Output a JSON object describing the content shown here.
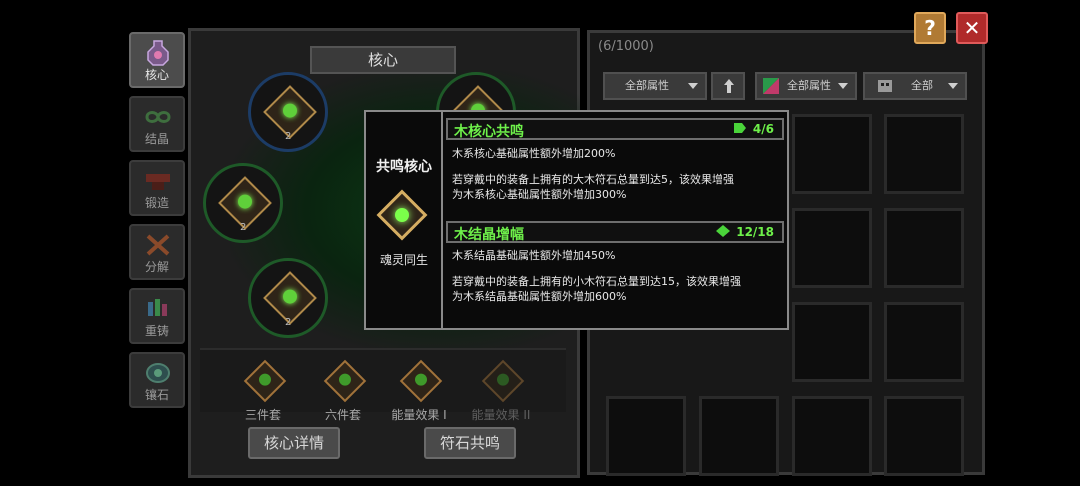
{
  "sidebar": {
    "items": [
      {
        "label": "核心",
        "icon": "vase-icon",
        "active": true
      },
      {
        "label": "结晶",
        "icon": "infinity-crystal-icon"
      },
      {
        "label": "锻造",
        "icon": "anvil-icon"
      },
      {
        "label": "分解",
        "icon": "decompose-icon"
      },
      {
        "label": "重铸",
        "icon": "recast-crystals-icon"
      },
      {
        "label": "镶石",
        "icon": "socket-stone-icon"
      }
    ]
  },
  "core": {
    "title": "核心",
    "sockets": [
      {
        "level": "2"
      },
      {
        "level": "2"
      },
      {
        "level": "2"
      },
      {
        "level": ""
      }
    ],
    "sets": [
      {
        "label": "三件套",
        "dim": false
      },
      {
        "label": "六件套",
        "dim": false
      },
      {
        "label": "能量效果 I",
        "dim": false
      },
      {
        "label": "能量效果 II",
        "dim": true
      }
    ],
    "detail_button": "核心详情",
    "resonance_button": "符石共鸣"
  },
  "inventory": {
    "count": "(6/1000)",
    "filters": {
      "attr1": "全部属性",
      "sort_icon": "up-arrow-icon",
      "attr2": "全部属性",
      "all": "全部"
    }
  },
  "buttons": {
    "help": "?",
    "close": "✕"
  },
  "tooltip": {
    "left_title": "共鸣核心",
    "left_name": "魂灵同生",
    "section1": {
      "title": "木核心共鸣",
      "count": "4/6",
      "line1": "木系核心基础属性额外增加200%",
      "line2": "若穿戴中的装备上拥有的大木符石总量到达5，该效果增强",
      "line3": "为木系核心基础属性额外增加300%"
    },
    "section2": {
      "title": "木结晶增幅",
      "count": "12/18",
      "line1": "木系结晶基础属性额外增加450%",
      "line2": "若穿戴中的装备上拥有的小木符石总量到达15，该效果增强",
      "line3": "为木系结晶基础属性额外增加600%"
    }
  },
  "colors": {
    "accent_green": "#6ef04a",
    "close_red": "#b02a2a",
    "help_orange": "#b07a34"
  }
}
